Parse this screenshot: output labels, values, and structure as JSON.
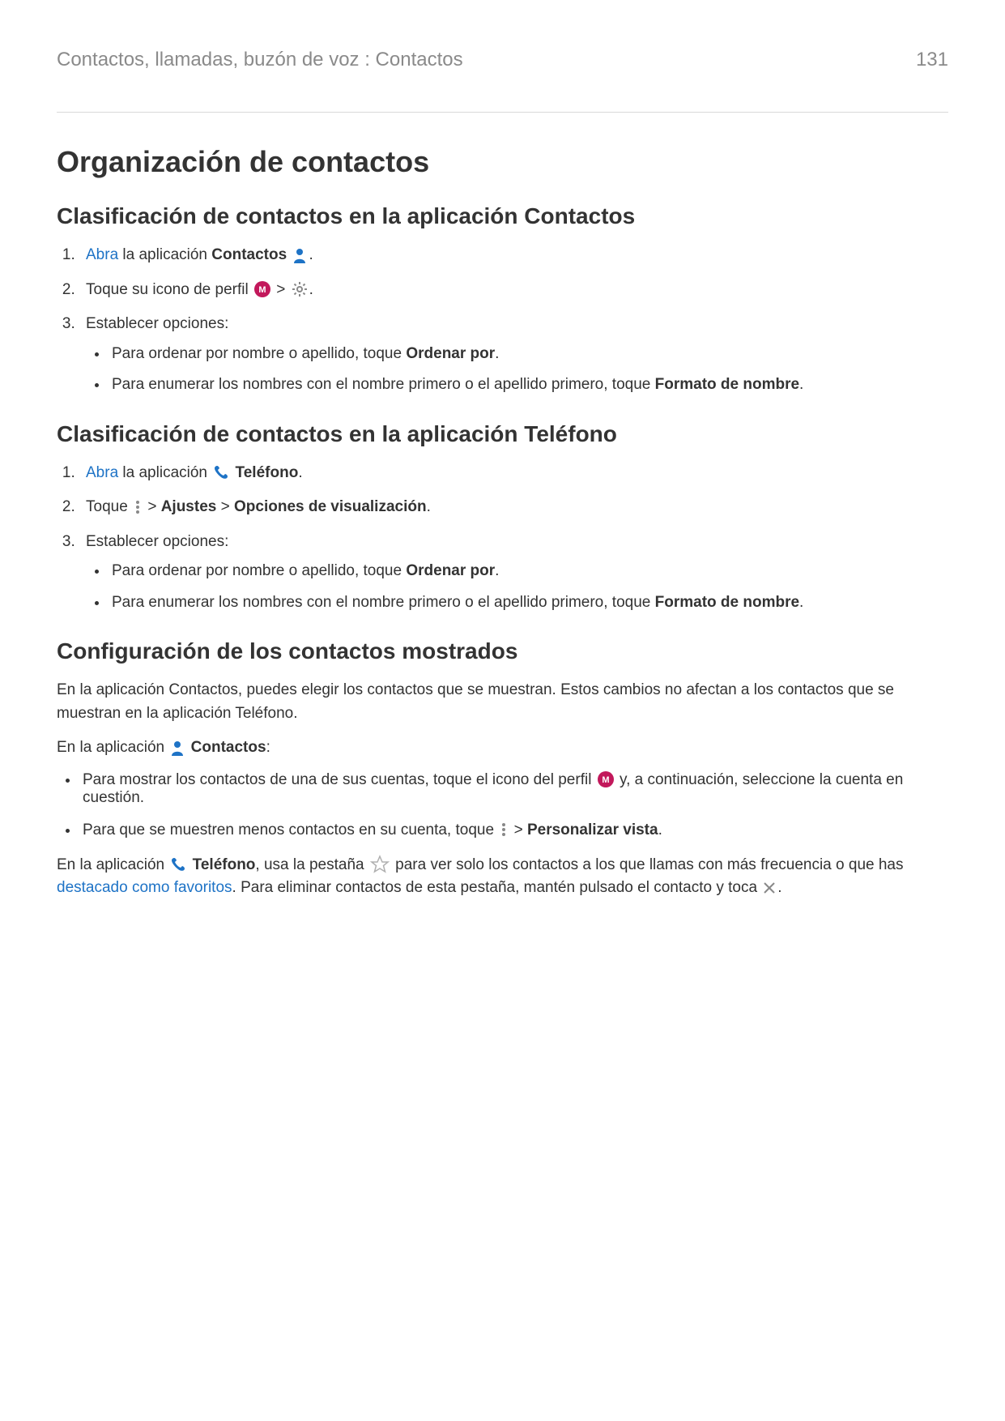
{
  "header": {
    "breadcrumb": "Contactos, llamadas, buzón de voz : Contactos",
    "page_number": "131"
  },
  "title": "Organización de contactos",
  "section1": {
    "heading": "Clasificación de contactos en la aplicación Contactos",
    "step1_link": "Abra",
    "step1_a": " la aplicación ",
    "step1_b": "Contactos",
    "step1_c": ".",
    "step2_a": "Toque su icono de perfil ",
    "step2_b": " > ",
    "step2_c": ".",
    "step3": "Establecer opciones:",
    "b1_a": "Para ordenar por nombre o apellido, toque ",
    "b1_b": "Ordenar por",
    "b1_c": ".",
    "b2_a": "Para enumerar los nombres con el nombre primero o el apellido primero, toque ",
    "b2_b": "Formato de nombre",
    "b2_c": "."
  },
  "section2": {
    "heading": "Clasificación de contactos en la aplicación Teléfono",
    "step1_link": "Abra",
    "step1_a": " la aplicación ",
    "step1_b": "Teléfono",
    "step1_c": ".",
    "step2_a": "Toque ",
    "step2_b": " > ",
    "step2_c": "Ajustes",
    "step2_d": " > ",
    "step2_e": "Opciones de visualización",
    "step2_f": ".",
    "step3": "Establecer opciones:",
    "b1_a": "Para ordenar por nombre o apellido, toque ",
    "b1_b": "Ordenar por",
    "b1_c": ".",
    "b2_a": "Para enumerar los nombres con el nombre primero o el apellido primero, toque ",
    "b2_b": "Formato de nombre",
    "b2_c": "."
  },
  "section3": {
    "heading": "Configuración de los contactos mostrados",
    "p1": "En la aplicación Contactos, puedes elegir los contactos que se muestran. Estos cambios no afectan a los contactos que se muestran en la aplicación Teléfono.",
    "p2_a": "En la aplicación ",
    "p2_b": "Contactos",
    "p2_c": ":",
    "b1_a": "Para mostrar los contactos de una de sus cuentas, toque el icono del perfil ",
    "b1_b": " y, a continuación, seleccione la cuenta en cuestión.",
    "b2_a": "Para que se muestren menos contactos en su cuenta, toque ",
    "b2_b": " > ",
    "b2_c": "Personalizar vista",
    "b2_d": ".",
    "p3_a": "En la aplicación ",
    "p3_b": "Teléfono",
    "p3_c": ", usa la pestaña ",
    "p3_d": " para ver solo los contactos a los que llamas con más frecuencia o que has ",
    "p3_link": "destacado como favoritos",
    "p3_e": ". Para eliminar contactos de esta pestaña, mantén pulsado el contacto y toca ",
    "p3_f": "."
  }
}
